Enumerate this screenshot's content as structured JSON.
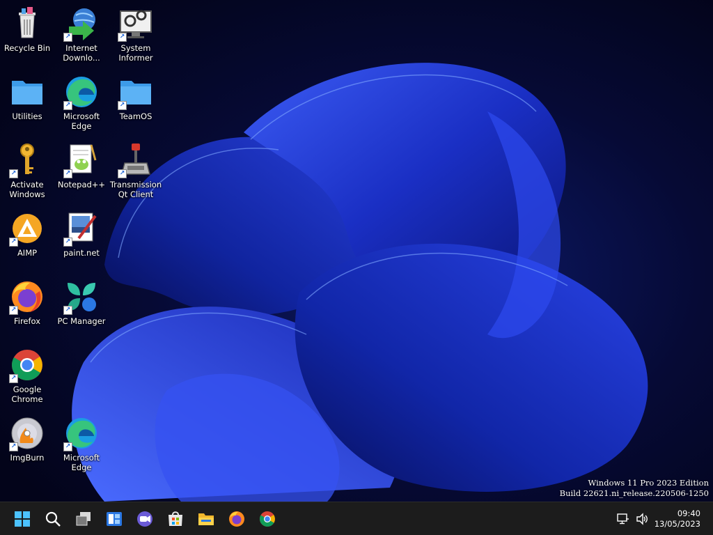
{
  "desktop": {
    "icons": [
      {
        "label": "Recycle Bin",
        "icon": "recycle-bin-icon",
        "shortcut": false
      },
      {
        "label": "Internet\nDownlo...",
        "icon": "internet-download-manager-icon",
        "shortcut": true
      },
      {
        "label": "System\nInformer",
        "icon": "system-informer-icon",
        "shortcut": true
      },
      {
        "label": "Utilities",
        "icon": "folder-icon",
        "shortcut": false
      },
      {
        "label": "Microsoft\nEdge",
        "icon": "edge-icon",
        "shortcut": true
      },
      {
        "label": "TeamOS",
        "icon": "folder-icon",
        "shortcut": true
      },
      {
        "label": "Activate\nWindows",
        "icon": "key-icon",
        "shortcut": true
      },
      {
        "label": "Notepad++",
        "icon": "notepad-plus-plus-icon",
        "shortcut": true
      },
      {
        "label": "Transmission\nQt Client",
        "icon": "transmission-icon",
        "shortcut": true
      },
      {
        "label": "AIMP",
        "icon": "aimp-icon",
        "shortcut": true
      },
      {
        "label": "paint.net",
        "icon": "paint-net-icon",
        "shortcut": true
      },
      {
        "label": "Firefox",
        "icon": "firefox-icon",
        "shortcut": true
      },
      {
        "label": "PC Manager",
        "icon": "pc-manager-icon",
        "shortcut": true
      },
      {
        "label": "Google\nChrome",
        "icon": "chrome-icon",
        "shortcut": true
      },
      {
        "label": "ImgBurn",
        "icon": "imgburn-icon",
        "shortcut": true
      },
      {
        "label": "Microsoft\nEdge",
        "icon": "edge-icon",
        "shortcut": true
      }
    ]
  },
  "watermark": {
    "line1": "Windows 11 Pro 2023 Edition",
    "line2": "Build 22621.ni_release.220506-1250"
  },
  "taskbar": {
    "buttons": [
      {
        "icon": "windows-start-icon"
      },
      {
        "icon": "search-icon"
      },
      {
        "icon": "task-view-icon"
      },
      {
        "icon": "widgets-icon"
      },
      {
        "icon": "teams-chat-icon"
      },
      {
        "icon": "microsoft-store-icon"
      },
      {
        "icon": "file-explorer-icon"
      },
      {
        "icon": "firefox-icon"
      },
      {
        "icon": "chrome-icon"
      }
    ],
    "tray": {
      "network": "network-icon",
      "volume": "volume-icon"
    },
    "clock": {
      "time": "09:40",
      "date": "13/05/2023"
    }
  },
  "colors": {
    "taskbar_bg": "#1c1c1c",
    "wallpaper_dark": "#05061a",
    "bloom_blue": "#1f37d9",
    "accent": "#4cc2ff"
  }
}
